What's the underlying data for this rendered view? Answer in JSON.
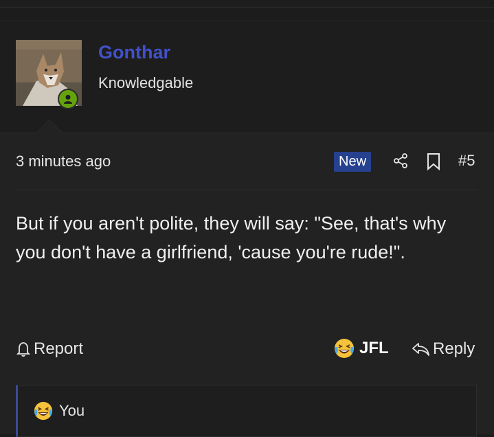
{
  "user": {
    "name": "Gonthar",
    "title": "Knowledgable"
  },
  "post": {
    "timestamp": "3 minutes ago",
    "badge": "New",
    "number": "#5",
    "message": "But if you aren't polite, they will say: \"See, that's why you don't have a girlfriend, 'cause you're rude!\"."
  },
  "actions": {
    "report_label": "Report",
    "reaction_label": "JFL",
    "reply_label": "Reply"
  },
  "reactions_summary": {
    "text": "You",
    "emoji": "crying-laughing-icon"
  },
  "colors": {
    "username": "#4251c8",
    "badge": "#26418f",
    "online": "#65a30d",
    "accent_border": "#3c4a9a"
  }
}
